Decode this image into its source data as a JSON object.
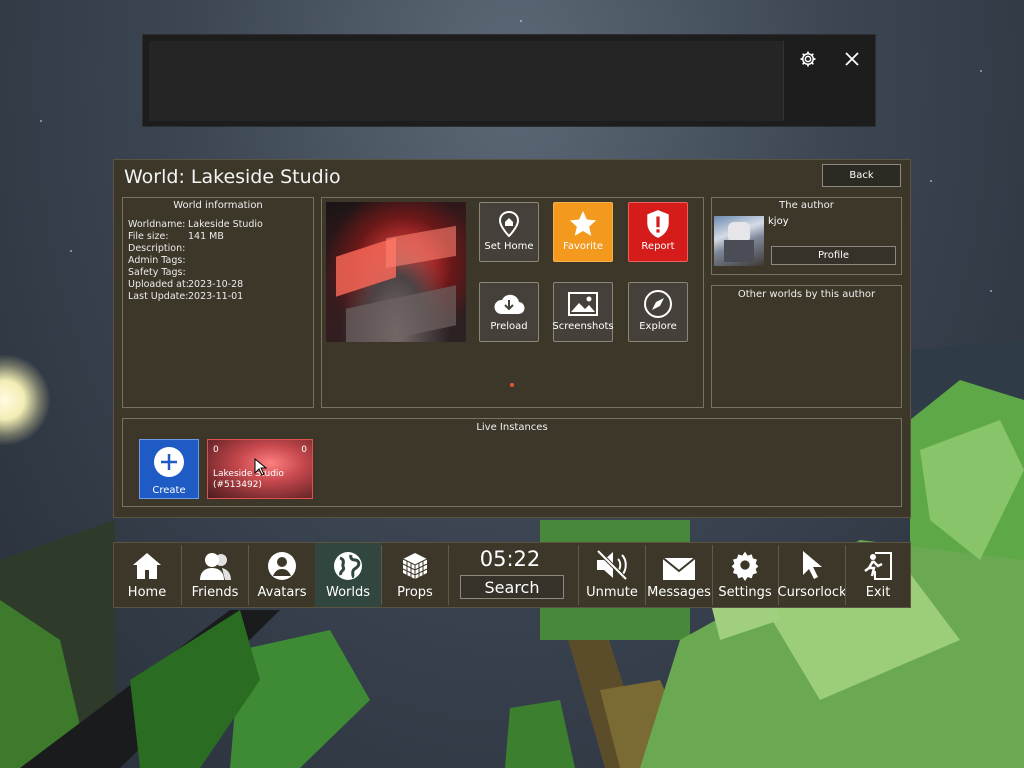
{
  "top_bar": {
    "settings_icon": "gear-icon",
    "close_icon": "close-icon"
  },
  "panel": {
    "title": "World: Lakeside Studio",
    "back_label": "Back",
    "world_info": {
      "heading": "World information",
      "rows": [
        {
          "key": "Worldname:",
          "value": "Lakeside Studio"
        },
        {
          "key": "File size:",
          "value": "141 MB"
        },
        {
          "key": "Description:",
          "value": ""
        },
        {
          "key": "Admin Tags:",
          "value": ""
        },
        {
          "key": "Safety Tags:",
          "value": ""
        },
        {
          "key": "Uploaded at:",
          "value": "2023-10-28"
        },
        {
          "key": "Last Update:",
          "value": "2023-11-01"
        }
      ]
    },
    "actions": {
      "set_home": "Set Home",
      "favorite": "Favorite",
      "report": "Report",
      "preload": "Preload",
      "screenshots": "Screenshots",
      "explore": "Explore"
    },
    "colors": {
      "favorite": "#f39a1e",
      "report": "#d61b1b",
      "create": "#1e5bc4",
      "panel": "#3c3729"
    },
    "author": {
      "heading": "The author",
      "name": "kjoy",
      "profile_label": "Profile"
    },
    "other_worlds": {
      "heading": "Other worlds by this author"
    },
    "live_instances": {
      "heading": "Live Instances",
      "create_label": "Create",
      "instances": [
        {
          "count_left": "0",
          "count_right": "0",
          "name": "Lakeside Studio",
          "id": "(#513492)"
        }
      ]
    }
  },
  "nav": {
    "time": "05:22",
    "search_label": "Search",
    "items": {
      "home": "Home",
      "friends": "Friends",
      "avatars": "Avatars",
      "worlds": "Worlds",
      "props": "Props",
      "unmute": "Unmute",
      "messages": "Messages",
      "settings": "Settings",
      "cursorlock": "Cursorlock",
      "exit": "Exit"
    },
    "active": "Worlds"
  }
}
